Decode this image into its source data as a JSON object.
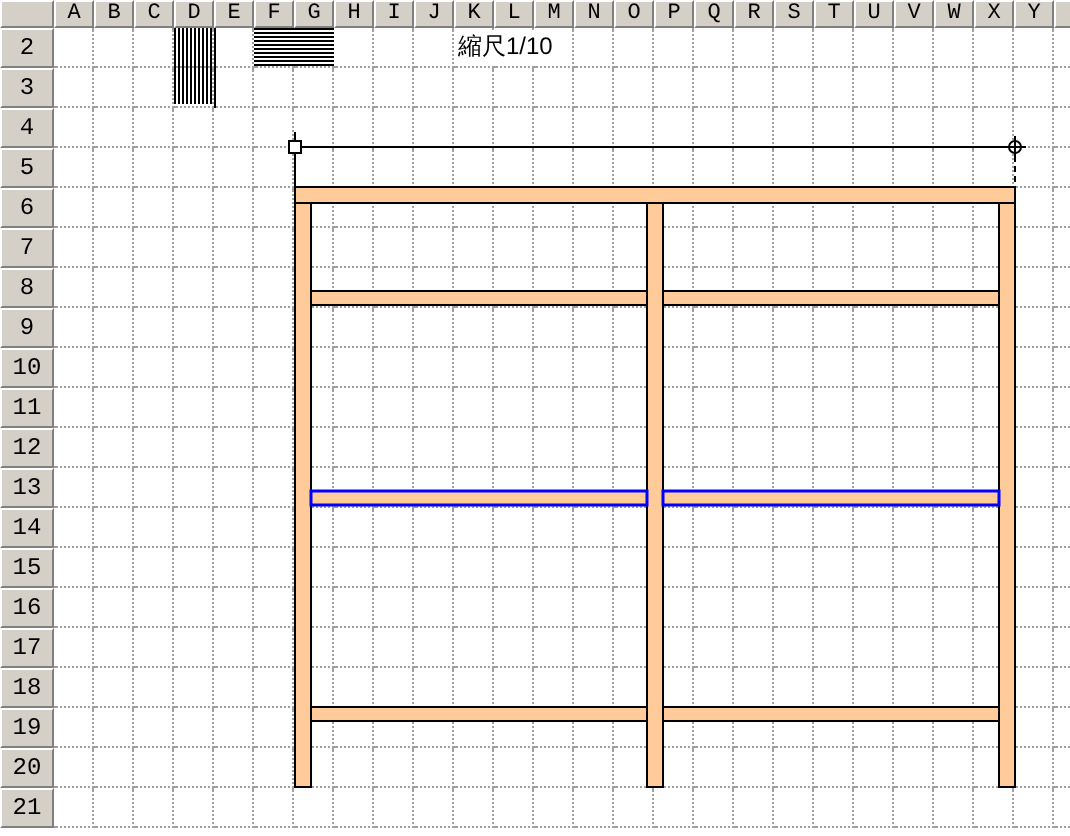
{
  "columns": [
    "A",
    "B",
    "C",
    "D",
    "E",
    "F",
    "G",
    "H",
    "I",
    "J",
    "K",
    "L",
    "M",
    "N",
    "O",
    "P",
    "Q",
    "R",
    "S",
    "T",
    "U",
    "V",
    "W",
    "X",
    "Y"
  ],
  "rows": [
    "2",
    "3",
    "4",
    "5",
    "6",
    "7",
    "8",
    "9",
    "10",
    "11",
    "12",
    "13",
    "14",
    "15",
    "16",
    "17",
    "18",
    "19",
    "20",
    "21"
  ],
  "scale_label": "縮尺1/10",
  "drawing": {
    "shelves": [
      {
        "selected": false
      },
      {
        "selected": true
      },
      {
        "selected": false
      }
    ]
  }
}
